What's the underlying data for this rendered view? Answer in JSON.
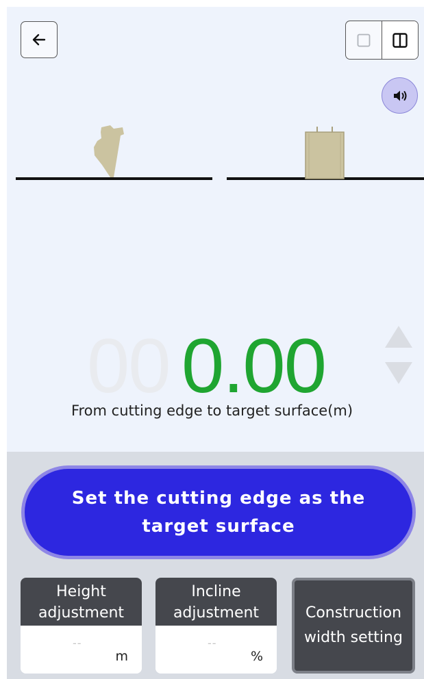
{
  "header": {
    "back_icon": "arrow-left-icon",
    "view_toggle": {
      "single_icon": "single-view-icon",
      "split_icon": "split-view-icon",
      "selected": "split"
    },
    "sound_icon": "speaker-icon"
  },
  "visual": {
    "left_icon": "bucket-side-view",
    "right_icon": "bucket-front-view",
    "bucket_color": "#cbc3a0"
  },
  "readout": {
    "ghost_digits": "00",
    "value": "0.00",
    "value_color": "#1fa531",
    "caption": "From cutting edge to target surface(m)",
    "up_icon": "triangle-up-icon",
    "down_icon": "triangle-down-icon"
  },
  "actions": {
    "primary_label": "Set the cutting edge as the target surface",
    "primary_color": "#2d27e0",
    "height": {
      "title": "Height adjustment",
      "value": "--",
      "unit": "m"
    },
    "incline": {
      "title": "Incline adjustment",
      "value": "--",
      "unit": "%"
    },
    "width_label": "Construction width setting"
  }
}
